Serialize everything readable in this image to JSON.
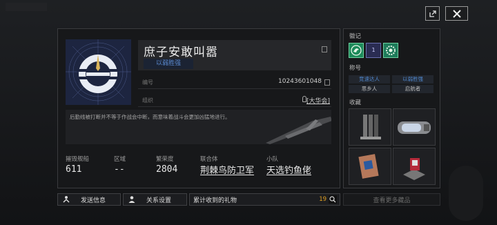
{
  "window": {
    "share_icon": "share-icon",
    "close_icon": "close-icon"
  },
  "profile": {
    "name": "庶子安敢叫嚣",
    "title_tag": "以弱胜强",
    "id_label": "编号",
    "id_value": "10243601048",
    "group_label": "组织",
    "group_value": "[大华会]",
    "description": "后勤线被打断并不等于作战会中断，而意味着战斗会更加凶猛地进行。"
  },
  "stats": [
    {
      "label": "摧毁舰船",
      "value": "611"
    },
    {
      "label": "区域",
      "value": "--"
    },
    {
      "label": "繁荣度",
      "value": "2804"
    },
    {
      "label": "联合体",
      "value": "荆棘鸟防卫军"
    },
    {
      "label": "小队",
      "value": "天选钓鱼佬"
    }
  ],
  "side": {
    "badges_header": "徽记",
    "badge_middle_text": "1",
    "titles_header": "称号",
    "titles": [
      {
        "label": "竞速达人",
        "color": "#4f86cc"
      },
      {
        "label": "以弱胜强",
        "color": "#4f86cc"
      },
      {
        "label": "思乡人",
        "color": "#bdbdbd"
      },
      {
        "label": "启航者",
        "color": "#bdbdbd"
      }
    ],
    "collection_header": "收藏",
    "more_button": "查看更多藏品"
  },
  "bottom": {
    "send_message": "发送信息",
    "relationship": "关系设置",
    "gifts_label": "累计收到的礼物",
    "gifts_count": "19"
  },
  "colors": {
    "accent_blue": "#4f86cc",
    "gift_count": "#e0a020",
    "badge_green": "#1d8a5a"
  }
}
